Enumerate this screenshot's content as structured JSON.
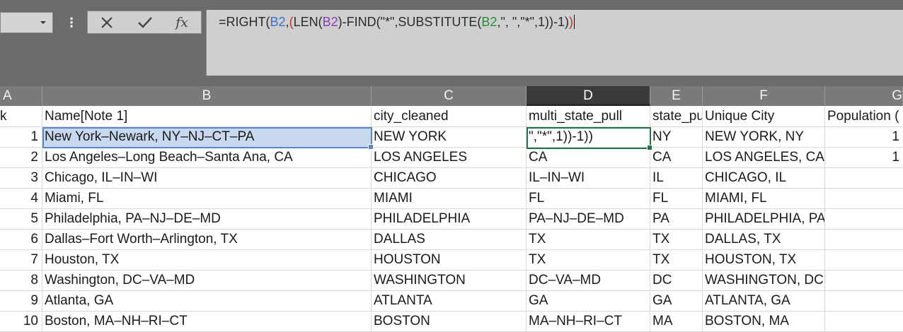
{
  "formula_bar": {
    "name_box_value": "",
    "cancel_icon": "x-icon",
    "enter_icon": "checkmark-icon",
    "function_label": "fx",
    "formula_parts": [
      {
        "text": "=RIGHT(",
        "color": "default"
      },
      {
        "text": "B2",
        "color": "blue"
      },
      {
        "text": ",",
        "color": "default"
      },
      {
        "text": "(",
        "color": "red"
      },
      {
        "text": "LEN(",
        "color": "default"
      },
      {
        "text": "B2",
        "color": "purple"
      },
      {
        "text": ")-FIND(",
        "color": "default"
      },
      {
        "text": "\"*\"",
        "color": "default"
      },
      {
        "text": ",SUBSTITUTE(",
        "color": "default"
      },
      {
        "text": "B2",
        "color": "green"
      },
      {
        "text": ",\", \",\"*\",1))-1)",
        "color": "default"
      },
      {
        "text": ")",
        "color": "red"
      }
    ]
  },
  "columns": [
    {
      "letter": "A"
    },
    {
      "letter": "B"
    },
    {
      "letter": "C"
    },
    {
      "letter": "D",
      "selected": true
    },
    {
      "letter": "E"
    },
    {
      "letter": "F"
    },
    {
      "letter": "G"
    }
  ],
  "header_row": {
    "row_num": "k",
    "cells": [
      "Name[Note 1]",
      "city_cleaned",
      "multi_state_pull",
      "state_pull",
      "Unique City",
      "Population ("
    ]
  },
  "rows": [
    {
      "num": "1",
      "cells": [
        "New York–Newark, NY–NJ–CT–PA",
        "NEW YORK",
        "\",\"*\",1))-1))",
        "NY",
        "NEW YORK, NY",
        "1"
      ]
    },
    {
      "num": "2",
      "cells": [
        "Los Angeles–Long Beach–Santa Ana, CA",
        "LOS ANGELES",
        "CA",
        "CA",
        "LOS ANGELES, CA",
        "1"
      ]
    },
    {
      "num": "3",
      "cells": [
        "Chicago, IL–IN–WI",
        "CHICAGO",
        "IL–IN–WI",
        "IL",
        "CHICAGO, IL",
        ""
      ]
    },
    {
      "num": "4",
      "cells": [
        "Miami, FL",
        "MIAMI",
        "FL",
        "FL",
        "MIAMI, FL",
        ""
      ]
    },
    {
      "num": "5",
      "cells": [
        "Philadelphia, PA–NJ–DE–MD",
        "PHILADELPHIA",
        "PA–NJ–DE–MD",
        "PA",
        "PHILADELPHIA, PA",
        ""
      ]
    },
    {
      "num": "6",
      "cells": [
        "Dallas–Fort Worth–Arlington, TX",
        "DALLAS",
        "TX",
        "TX",
        "DALLAS, TX",
        ""
      ]
    },
    {
      "num": "7",
      "cells": [
        "Houston, TX",
        "HOUSTON",
        "TX",
        "TX",
        "HOUSTON, TX",
        ""
      ]
    },
    {
      "num": "8",
      "cells": [
        "Washington, DC–VA–MD",
        "WASHINGTON",
        "DC–VA–MD",
        "DC",
        "WASHINGTON, DC",
        ""
      ]
    },
    {
      "num": "9",
      "cells": [
        "Atlanta, GA",
        "ATLANTA",
        "GA",
        "GA",
        "ATLANTA, GA",
        ""
      ]
    },
    {
      "num": "10",
      "cells": [
        "Boston, MA–NH–RI–CT",
        "BOSTON",
        "MA–NH–RI–CT",
        "MA",
        "BOSTON, MA",
        ""
      ]
    }
  ],
  "colors": {
    "selection_fill": "#c7d8ef",
    "active_border": "#217346",
    "range_border": "#5b87c7"
  }
}
